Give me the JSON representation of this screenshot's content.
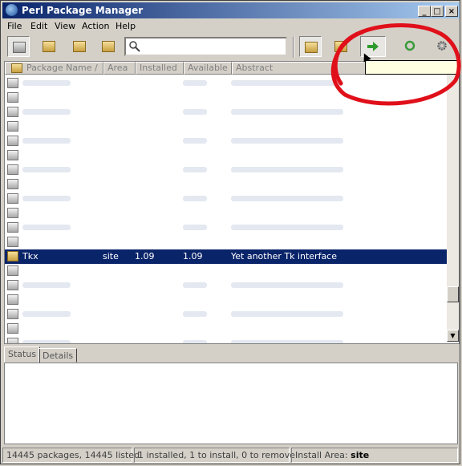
{
  "window": {
    "title": "Perl Package Manager"
  },
  "menu": {
    "items": [
      "File",
      "Edit",
      "View",
      "Action",
      "Help"
    ]
  },
  "toolbar": {
    "left_buttons": [
      "all-packages-icon",
      "installed-packages-icon",
      "upgradeable-packages-icon",
      "modified-packages-icon"
    ],
    "search": {
      "value": "",
      "placeholder": ""
    },
    "right_buttons": [
      "mark-install-icon",
      "mark-remove-icon",
      "run-marked-actions-icon",
      "sync-icon",
      "preferences-icon"
    ]
  },
  "table": {
    "columns": [
      "Package Name",
      "Area",
      "Installed",
      "Available",
      "Abstract"
    ],
    "sort_indicator": "/",
    "selected_row": {
      "name": "Tkx",
      "area": "site",
      "installed": "1.09",
      "available": "1.09",
      "abstract": "Yet another Tk interface"
    }
  },
  "tabs": [
    "Status",
    "Details"
  ],
  "statusbar": {
    "packages": "14445 packages, 14445 listed",
    "actions": "1 installed, 1 to install, 0 to remove",
    "area_label": "Install Area:",
    "area_value": "site"
  },
  "annotation_color": "#e0101a"
}
